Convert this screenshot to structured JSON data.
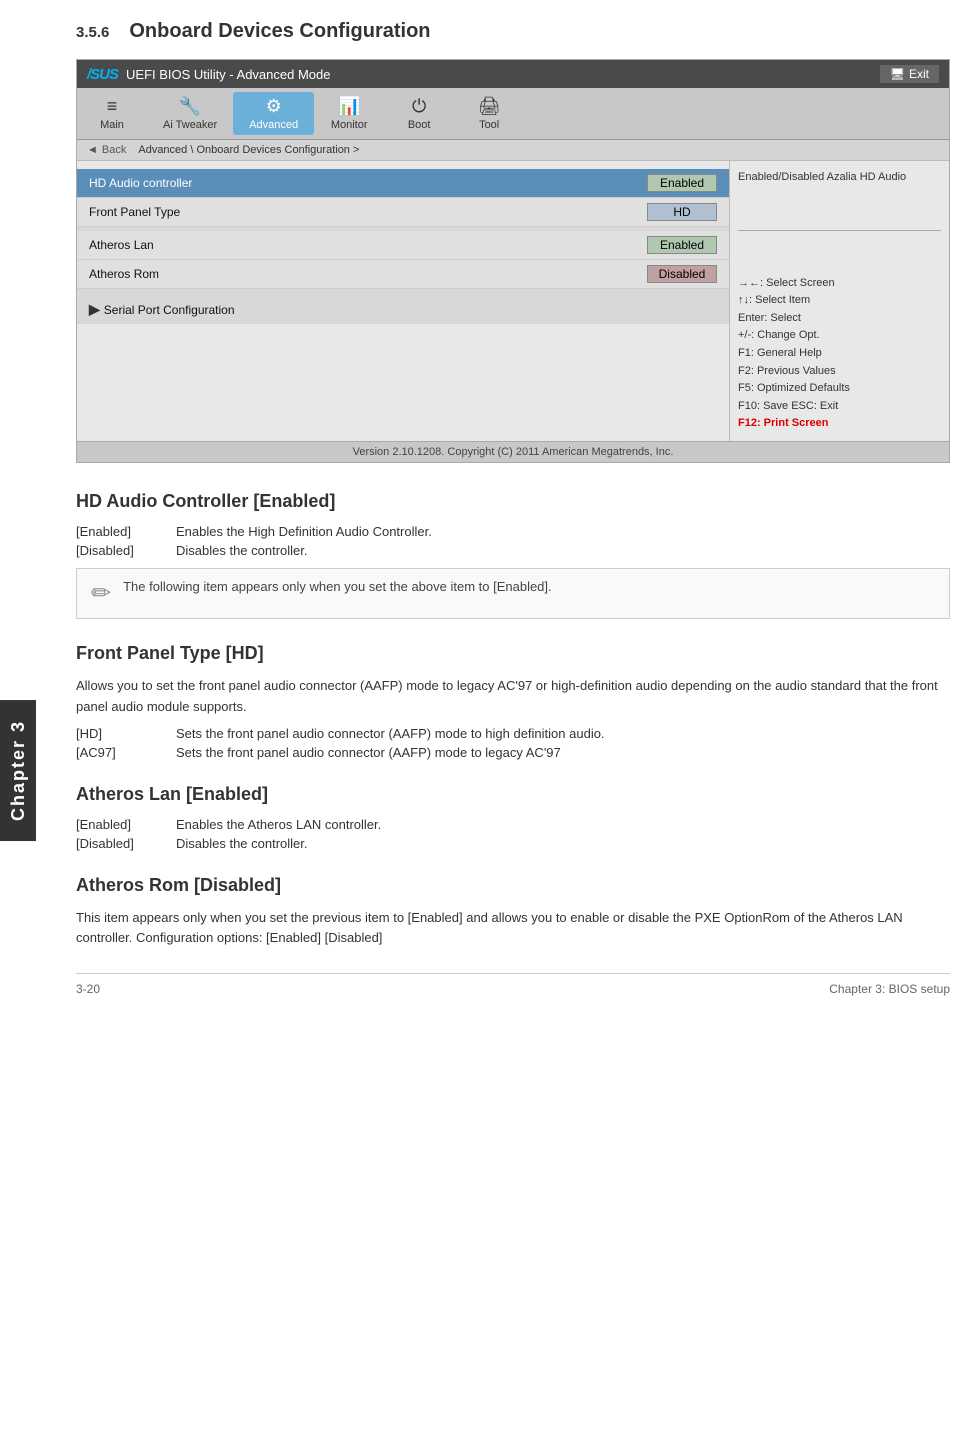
{
  "page": {
    "section_number": "3.5.6",
    "section_title": "Onboard Devices Configuration"
  },
  "bios": {
    "titlebar": {
      "logo": "/SUS",
      "title": "UEFI BIOS Utility - Advanced Mode",
      "exit_label": "Exit"
    },
    "nav": {
      "items": [
        {
          "id": "main",
          "label": "Main",
          "icon": "≡≡"
        },
        {
          "id": "ai-tweaker",
          "label": "Ai Tweaker",
          "icon": "🔧"
        },
        {
          "id": "advanced",
          "label": "Advanced",
          "icon": "⚙"
        },
        {
          "id": "monitor",
          "label": "Monitor",
          "icon": "📊"
        },
        {
          "id": "boot",
          "label": "Boot",
          "icon": "⏻"
        },
        {
          "id": "tool",
          "label": "Tool",
          "icon": "🖨"
        }
      ],
      "active": "advanced"
    },
    "breadcrumb": {
      "back_label": "Back",
      "path": "Advanced \\ Onboard Devices Configuration >"
    },
    "rows": [
      {
        "id": "hd-audio",
        "label": "HD Audio controller",
        "value": "Enabled",
        "value_type": "enabled",
        "selected": true
      },
      {
        "id": "front-panel",
        "label": "Front Panel Type",
        "value": "HD",
        "value_type": "hd"
      },
      {
        "id": "atheros-lan",
        "label": "Atheros Lan",
        "value": "Enabled",
        "value_type": "enabled"
      },
      {
        "id": "atheros-rom",
        "label": "Atheros Rom",
        "value": "Disabled",
        "value_type": "disabled"
      }
    ],
    "submenu": {
      "label": "Serial Port Configuration"
    },
    "right_panel": {
      "top_text": "Enabled/Disabled Azalia HD Audio",
      "shortcuts": [
        "→←: Select Screen",
        "↑↓: Select Item",
        "Enter: Select",
        "+/-: Change Opt.",
        "F1: General Help",
        "F2: Previous Values",
        "F5: Optimized Defaults",
        "F10: Save  ESC: Exit",
        "F12: Print Screen"
      ],
      "highlight_item": "F12: Print Screen"
    },
    "version": "Version 2.10.1208.  Copyright (C) 2011 American Megatrends, Inc."
  },
  "sections": {
    "hd_audio": {
      "heading": "HD Audio Controller [Enabled]",
      "options": [
        {
          "key": "[Enabled]",
          "desc": "Enables the High Definition Audio Controller."
        },
        {
          "key": "[Disabled]",
          "desc": "Disables the controller."
        }
      ],
      "note": "The following item appears only when you set the above item to [Enabled]."
    },
    "front_panel": {
      "heading": "Front Panel Type [HD]",
      "body": "Allows you to set the front panel audio connector (AAFP) mode to legacy AC'97 or high-definition audio depending on the audio standard that the front panel audio module supports.",
      "options": [
        {
          "key": "[HD]",
          "desc": "Sets the front panel audio connector (AAFP) mode to high definition audio."
        },
        {
          "key": "[AC97]",
          "desc": "Sets the front panel audio connector (AAFP) mode to legacy AC'97"
        }
      ]
    },
    "atheros_lan": {
      "heading": "Atheros Lan [Enabled]",
      "options": [
        {
          "key": "[Enabled]",
          "desc": "Enables the Atheros LAN controller."
        },
        {
          "key": "[Disabled]",
          "desc": "Disables the controller."
        }
      ]
    },
    "atheros_rom": {
      "heading": "Atheros Rom [Disabled]",
      "body": "This item appears only when you set the previous item to [Enabled] and allows you to enable or disable the PXE OptionRom of the Atheros LAN controller. Configuration options: [Enabled] [Disabled]"
    }
  },
  "footer": {
    "left": "3-20",
    "right": "Chapter 3: BIOS setup"
  },
  "chapter_label": "Chapter 3"
}
